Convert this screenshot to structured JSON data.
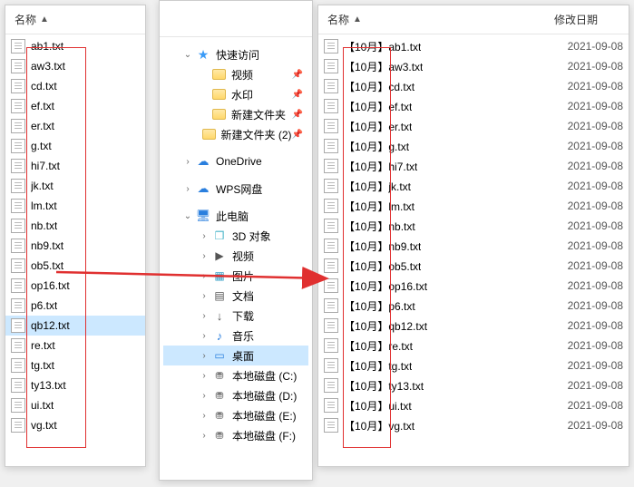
{
  "headers": {
    "name": "名称",
    "date": "修改日期"
  },
  "left": {
    "files": [
      "ab1.txt",
      "aw3.txt",
      "cd.txt",
      "ef.txt",
      "er.txt",
      "g.txt",
      "hi7.txt",
      "jk.txt",
      "lm.txt",
      "nb.txt",
      "nb9.txt",
      "ob5.txt",
      "op16.txt",
      "p6.txt",
      "qb12.txt",
      "re.txt",
      "tg.txt",
      "ty13.txt",
      "ui.txt",
      "vg.txt"
    ],
    "selected": "qb12.txt"
  },
  "right": {
    "prefix": "【10月】",
    "files": [
      "ab1.txt",
      "aw3.txt",
      "cd.txt",
      "ef.txt",
      "er.txt",
      "g.txt",
      "hi7.txt",
      "jk.txt",
      "lm.txt",
      "nb.txt",
      "nb9.txt",
      "ob5.txt",
      "op16.txt",
      "p6.txt",
      "qb12.txt",
      "re.txt",
      "tg.txt",
      "ty13.txt",
      "ui.txt",
      "vg.txt"
    ],
    "date": "2021-09-08"
  },
  "tree": [
    {
      "label": "快速访问",
      "icon": "star",
      "indent": 1,
      "exp": "v"
    },
    {
      "label": "视频",
      "icon": "folder",
      "indent": 2,
      "pin": true
    },
    {
      "label": "水印",
      "icon": "folder",
      "indent": 2,
      "pin": true
    },
    {
      "label": "新建文件夹",
      "icon": "folder",
      "indent": 2,
      "pin": true
    },
    {
      "label": "新建文件夹 (2)",
      "icon": "folder",
      "indent": 2,
      "pin": true
    },
    {
      "label": "OneDrive",
      "icon": "cloud",
      "indent": 1,
      "exp": ">"
    },
    {
      "label": "WPS网盘",
      "icon": "wps",
      "indent": 1,
      "exp": ">"
    },
    {
      "label": "此电脑",
      "icon": "pc",
      "indent": 1,
      "exp": "v"
    },
    {
      "label": "3D 对象",
      "icon": "3d",
      "indent": 2,
      "exp": ">"
    },
    {
      "label": "视频",
      "icon": "video",
      "indent": 2,
      "exp": ">"
    },
    {
      "label": "图片",
      "icon": "img",
      "indent": 2,
      "exp": ">"
    },
    {
      "label": "文档",
      "icon": "doc",
      "indent": 2,
      "exp": ">"
    },
    {
      "label": "下载",
      "icon": "down",
      "indent": 2,
      "exp": ">"
    },
    {
      "label": "音乐",
      "icon": "music",
      "indent": 2,
      "exp": ">"
    },
    {
      "label": "桌面",
      "icon": "desktop",
      "indent": 2,
      "exp": ">",
      "selected": true
    },
    {
      "label": "本地磁盘 (C:)",
      "icon": "disk",
      "indent": 2,
      "exp": ">"
    },
    {
      "label": "本地磁盘 (D:)",
      "icon": "disk",
      "indent": 2,
      "exp": ">"
    },
    {
      "label": "本地磁盘 (E:)",
      "icon": "disk",
      "indent": 2,
      "exp": ">"
    },
    {
      "label": "本地磁盘 (F:)",
      "icon": "disk",
      "indent": 2,
      "exp": ">"
    }
  ]
}
